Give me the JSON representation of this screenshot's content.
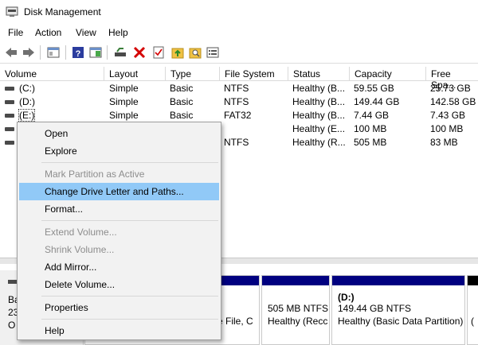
{
  "window": {
    "title": "Disk Management"
  },
  "menubar": {
    "file": "File",
    "action": "Action",
    "view": "View",
    "help": "Help"
  },
  "toolbar": {
    "icons": [
      "back-arrow-icon",
      "forward-arrow-icon",
      "console-tree-icon",
      "help-icon",
      "show-pane-icon",
      "connect-disk-icon",
      "delete-icon",
      "properties-check-icon",
      "folder-up-icon",
      "folder-search-icon",
      "list-view-icon"
    ],
    "colors": {
      "delete": "#d40000",
      "help": "#2b3c9e",
      "folder": "#f0c243"
    }
  },
  "columns": {
    "volume": "Volume",
    "layout": "Layout",
    "type": "Type",
    "filesystem": "File System",
    "status": "Status",
    "capacity": "Capacity",
    "free": "Free Spa..."
  },
  "volumes": [
    {
      "name": "(C:)",
      "layout": "Simple",
      "type": "Basic",
      "fs": "NTFS",
      "status": "Healthy (B...",
      "capacity": "59.55 GB",
      "free": "25.73 GB"
    },
    {
      "name": "(D:)",
      "layout": "Simple",
      "type": "Basic",
      "fs": "NTFS",
      "status": "Healthy (B...",
      "capacity": "149.44 GB",
      "free": "142.58 GB"
    },
    {
      "name": "(E:)",
      "layout": "Simple",
      "type": "Basic",
      "fs": "FAT32",
      "status": "Healthy (B...",
      "capacity": "7.44 GB",
      "free": "7.43 GB"
    },
    {
      "name": "",
      "layout": "",
      "type": "",
      "fs": "",
      "status": "Healthy (E...",
      "capacity": "100 MB",
      "free": "100 MB"
    },
    {
      "name": "",
      "layout": "",
      "type": "",
      "fs": "NTFS",
      "status": "Healthy (R...",
      "capacity": "505 MB",
      "free": "83 MB"
    }
  ],
  "context_menu": {
    "open": "Open",
    "explore": "Explore",
    "mark_active": "Mark Partition as Active",
    "change_letter": "Change Drive Letter and Paths...",
    "format": "Format...",
    "extend": "Extend Volume...",
    "shrink": "Shrink Volume...",
    "add_mirror": "Add Mirror...",
    "delete": "Delete Volume...",
    "properties": "Properties",
    "help": "Help",
    "highlight_color": "#91c9f7"
  },
  "disk_pane": {
    "disk_label": {
      "line1": "Ba",
      "line2": "23",
      "line3": "O"
    },
    "partition_a": {
      "line2": "e File, C"
    },
    "partition_b": {
      "line1": "505 MB NTFS",
      "line2": "Healthy (Recc"
    },
    "partition_c": {
      "name": "(D:)",
      "line1": "149.44 GB NTFS",
      "line2": "Healthy (Basic Data Partition)"
    },
    "partition_d": {
      "line2": "("
    },
    "bar_color": "#000080"
  }
}
